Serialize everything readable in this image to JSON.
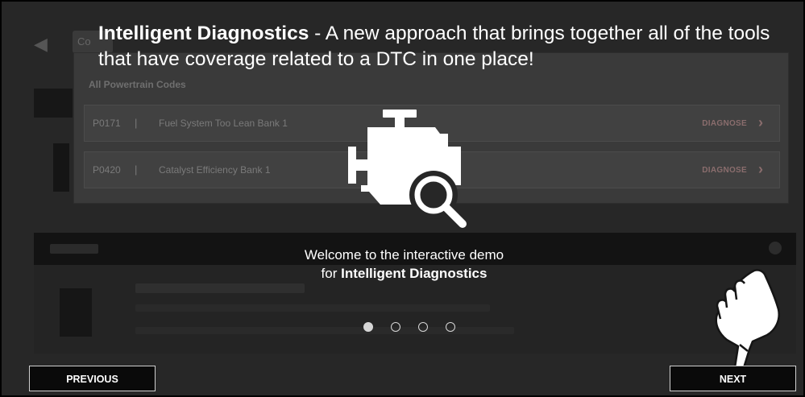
{
  "headline": {
    "strong": "Intelligent Diagnostics",
    "rest": " - A new approach that brings together all of the tools that have coverage related to a DTC in one place!"
  },
  "background": {
    "tab_label": "Co",
    "panel_title": "All Powertrain Codes",
    "codes": [
      {
        "code": "P0171",
        "separator": "|",
        "description": "Fuel System Too Lean Bank 1",
        "action": "DIAGNOSE"
      },
      {
        "code": "P0420",
        "separator": "|",
        "description": "Catalyst Efficiency Bank 1",
        "action": "DIAGNOSE"
      }
    ]
  },
  "welcome": {
    "line1": "Welcome to the interactive demo",
    "line2_prefix": "for ",
    "line2_strong": "Intelligent Diagnostics"
  },
  "pagination": {
    "total": 4,
    "current": 1
  },
  "navigation": {
    "previous_label": "PREVIOUS",
    "next_label": "NEXT"
  },
  "icons": {
    "engine": "engine-search-icon",
    "hand": "pointing-hand-icon",
    "chevron": "chevron-right-icon"
  },
  "colors": {
    "overlay_text": "#ffffff",
    "button_border": "#d0d0d0",
    "diagnose_text": "#8a6d6d"
  }
}
